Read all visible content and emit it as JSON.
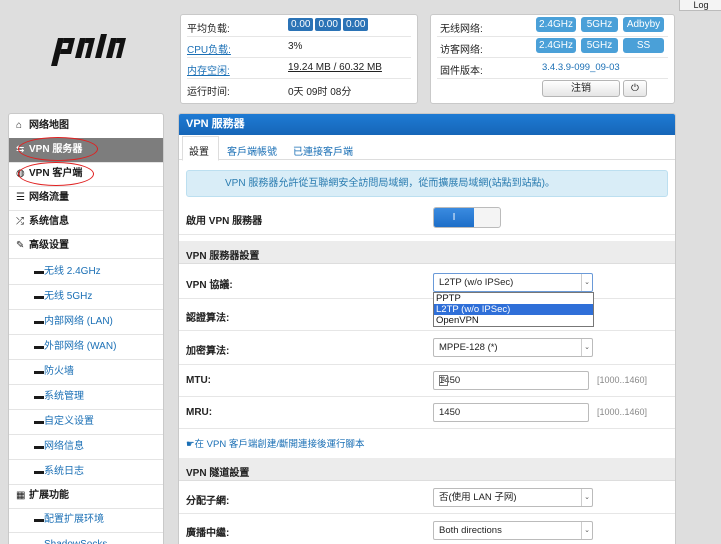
{
  "top": {
    "log_label": "Log",
    "logo_text": "padavan"
  },
  "info": {
    "load_label": "平均负载:",
    "load_values": [
      "0.00",
      "0.00",
      "0.00"
    ],
    "cpu_label": "CPU负载:",
    "cpu_value": "3%",
    "mem_label": "内存空闲:",
    "mem_value": "19.24 MB / 60.32 MB",
    "uptime_label": "运行时间:",
    "uptime_value": "0天 09时 08分"
  },
  "net": {
    "wireless_label": "无线网络:",
    "wireless_chips": [
      "2.4GHz",
      "5GHz",
      "Adbyby"
    ],
    "guest_label": "访客网络:",
    "guest_chips": [
      "2.4GHz",
      "5GHz",
      "SS"
    ],
    "fw_label": "固件版本:",
    "fw_value": "3.4.3.9-099_09-03",
    "logout_label": "注销",
    "power_icon": "⏻"
  },
  "sidebar": {
    "items": [
      {
        "icon": "home-icon",
        "glyph": "⌂",
        "label": "网络地图"
      },
      {
        "icon": "swap-icon",
        "glyph": "⇆",
        "label": "VPN 服务器"
      },
      {
        "icon": "globe-icon",
        "glyph": "◍",
        "label": "VPN 客户端"
      },
      {
        "icon": "list-icon",
        "glyph": "☰",
        "label": "网络流量"
      },
      {
        "icon": "shuffle-icon",
        "glyph": "⤮",
        "label": "系统信息"
      },
      {
        "icon": "wrench-icon",
        "glyph": "✎",
        "label": "高级设置"
      },
      {
        "icon": "dash-icon",
        "glyph": "▬",
        "label": "无线 2.4GHz"
      },
      {
        "icon": "dash-icon",
        "glyph": "▬",
        "label": "无线 5GHz"
      },
      {
        "icon": "dash-icon",
        "glyph": "▬",
        "label": "内部网络 (LAN)"
      },
      {
        "icon": "dash-icon",
        "glyph": "▬",
        "label": "外部网络 (WAN)"
      },
      {
        "icon": "dash-icon",
        "glyph": "▬",
        "label": "防火墙"
      },
      {
        "icon": "dash-icon",
        "glyph": "▬",
        "label": "系统管理"
      },
      {
        "icon": "dash-icon",
        "glyph": "▬",
        "label": "自定义设置"
      },
      {
        "icon": "dash-icon",
        "glyph": "▬",
        "label": "网络信息"
      },
      {
        "icon": "dash-icon",
        "glyph": "▬",
        "label": "系统日志"
      },
      {
        "icon": "grid-icon",
        "glyph": "▦",
        "label": "扩展功能"
      },
      {
        "icon": "dash-icon",
        "glyph": "▬",
        "label": "配置扩展环境"
      },
      {
        "icon": "dash-icon",
        "glyph": "▬",
        "label": "ShadowSocks"
      }
    ]
  },
  "main": {
    "title": "VPN 服務器",
    "tabs": [
      "設置",
      "客戶端帳號",
      "已連接客戶端"
    ],
    "alert": "VPN 服務器允許從互聯網安全訪問局域網，從而擴展局域網(站點到站點)。",
    "enable_label": "啟用 VPN 服務器",
    "toggle_on": "I",
    "section1": "VPN 服務器設置",
    "protocol_label": "VPN 協議:",
    "protocol_value": "L2TP (w/o IPSec)",
    "protocol_options": [
      "PPTP",
      "L2TP (w/o IPSec)",
      "OpenVPN"
    ],
    "auth_label": "認證算法:",
    "enc_label": "加密算法:",
    "enc_value": "MPPE-128 (*)",
    "mtu_label": "MTU:",
    "mtu_value": "1450",
    "mtu_range": "[1000..1460]",
    "mru_label": "MRU:",
    "mru_value": "1450",
    "mru_range": "[1000..1460]",
    "script_note": "在 VPN 客戶端創建/斷開連接後運行腳本",
    "section2": "VPN 隧道設置",
    "subnet_label": "分配子網:",
    "subnet_value": "否(使用 LAN 子网)",
    "broadcast_label": "廣播中繼:",
    "broadcast_value": "Both directions"
  }
}
